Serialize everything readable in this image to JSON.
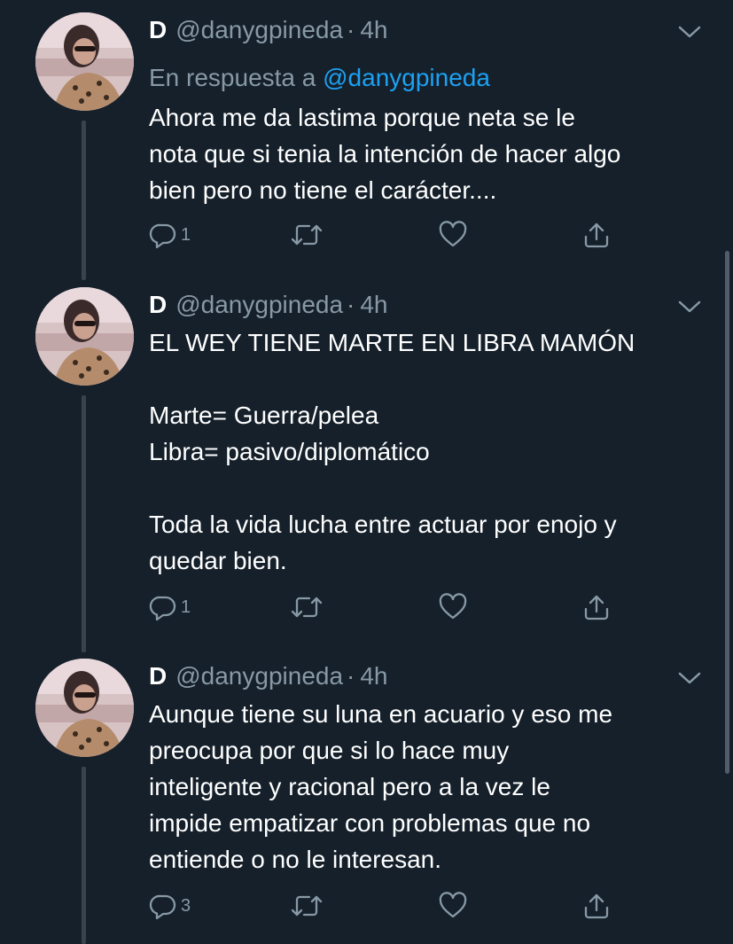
{
  "tweets": [
    {
      "display_name": "D",
      "handle": "@danygpineda",
      "separator": "·",
      "time": "4h",
      "reply_prefix": "En respuesta a",
      "reply_mention": "@danygpineda",
      "text": "Ahora me da lastima porque neta se le\nnota que si tenia la intención de hacer algo\nbien pero no tiene el carácter....",
      "reply_count": "1"
    },
    {
      "display_name": "D",
      "handle": "@danygpineda",
      "separator": "·",
      "time": "4h",
      "text": "EL WEY TIENE MARTE EN LIBRA MAMÓN\n\nMarte= Guerra/pelea\nLibra= pasivo/diplomático\n\nToda la vida lucha entre actuar por enojo y\nquedar bien.",
      "reply_count": "1"
    },
    {
      "display_name": "D",
      "handle": "@danygpineda",
      "separator": "·",
      "time": "4h",
      "text": "Aunque tiene su luna en acuario y eso me\npreocupa por que si lo hace muy\ninteligente y racional pero a la vez le\nimpide empatizar con problemas que no\nentiende o no le interesan.",
      "reply_count": "3"
    }
  ],
  "icons": {
    "reply": "reply-icon",
    "retweet": "retweet-icon",
    "like": "like-icon",
    "share": "share-icon",
    "more": "chevron-down-icon"
  },
  "colors": {
    "background": "#15202b",
    "text": "#ffffff",
    "secondary": "#8899a6",
    "link": "#1da1f2",
    "thread_line": "#38444d"
  }
}
